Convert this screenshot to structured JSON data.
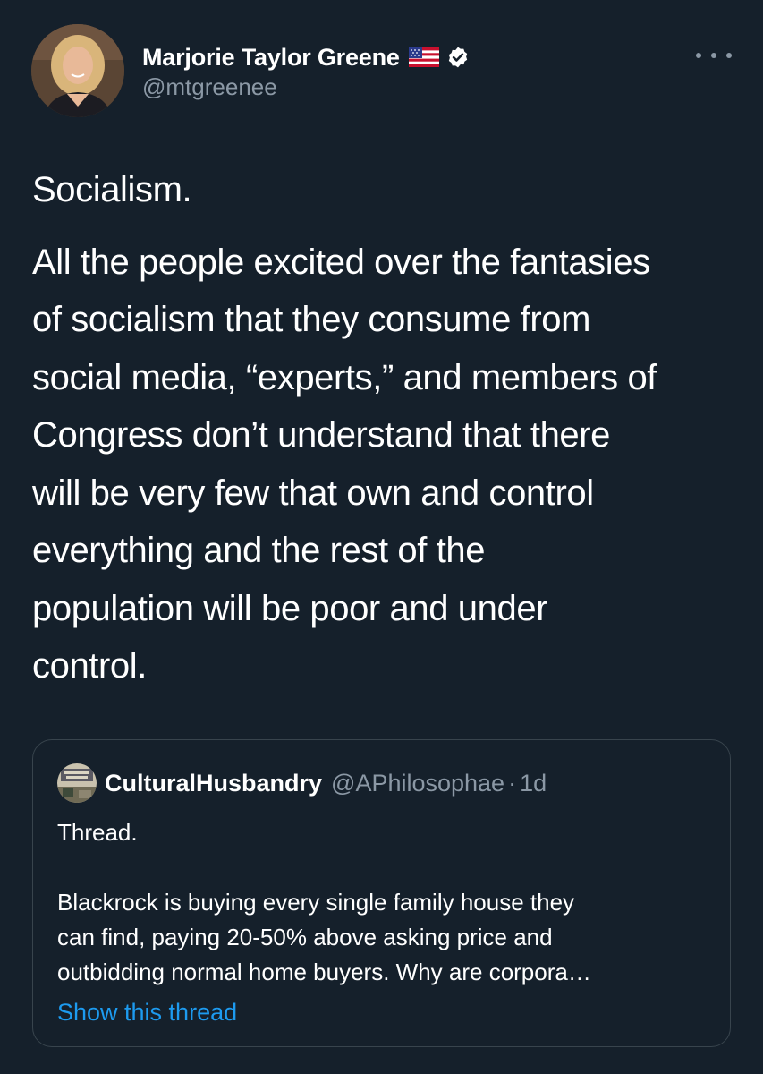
{
  "tweet": {
    "author": {
      "name": "Marjorie Taylor Greene",
      "handle": "@mtgreenee",
      "flag_icon": "us-flag-icon",
      "verified_icon": "verified-badge-icon"
    },
    "more_icon": "more-options-icon",
    "text_lines": [
      "Socialism.",
      "All the people excited over the fantasies",
      "of socialism that they consume from",
      "social media, “experts,” and members of",
      "Congress don’t understand that there",
      "will be very few that own and control",
      "everything and the rest of the",
      "population will be poor and under",
      "control."
    ],
    "quoted": {
      "name": "CulturalHusbandry",
      "handle": "@APhilosophae",
      "separator": "·",
      "time": "1d",
      "text_lines": [
        "Thread.",
        "",
        "Blackrock is buying every single family house they",
        "can find, paying 20-50% above asking price and",
        "outbidding normal home buyers. Why are corpora…"
      ],
      "show_thread": "Show this thread"
    }
  },
  "colors": {
    "background": "#15202b",
    "text": "#ffffff",
    "secondary": "#8b98a5",
    "accent": "#1d9bf0",
    "border": "#38444d"
  }
}
